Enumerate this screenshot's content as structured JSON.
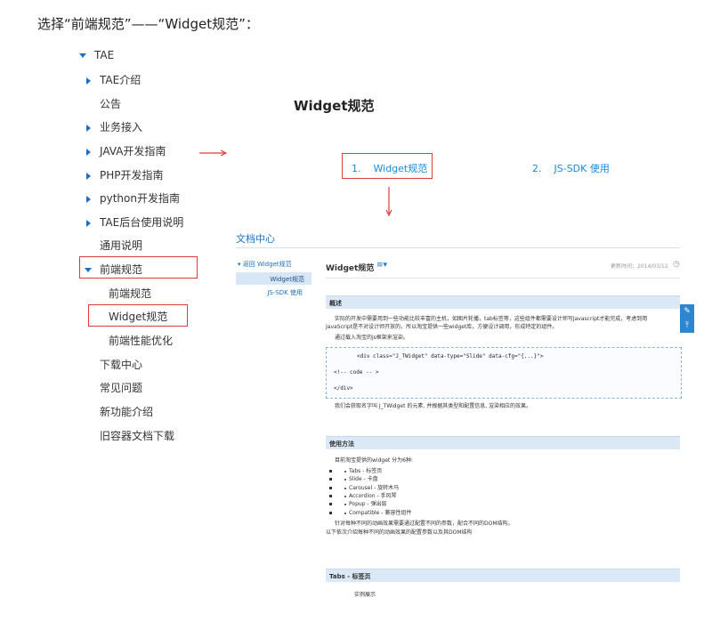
{
  "heading": "选择“前端规范”——“Widget规范”：",
  "tree": {
    "root": "TAE",
    "items": [
      {
        "label": "TAE介绍",
        "arrow": "right"
      },
      {
        "label": "公告",
        "arrow": "none"
      },
      {
        "label": "业务接入",
        "arrow": "right"
      },
      {
        "label": "JAVA开发指南",
        "arrow": "right"
      },
      {
        "label": "PHP开发指南",
        "arrow": "right"
      },
      {
        "label": "python开发指南",
        "arrow": "right"
      },
      {
        "label": "TAE后台使用说明",
        "arrow": "right"
      },
      {
        "label": "通用说明",
        "arrow": "none"
      },
      {
        "label": "前端规范",
        "arrow": "down"
      },
      {
        "label": "前端规范",
        "arrow": "none"
      },
      {
        "label": "Widget规范",
        "arrow": "none"
      },
      {
        "label": "前端性能优化",
        "arrow": "none"
      },
      {
        "label": "下载中心",
        "arrow": "none"
      },
      {
        "label": "常见问题",
        "arrow": "none"
      },
      {
        "label": "新功能介绍",
        "arrow": "none"
      },
      {
        "label": "旧容器文档下载",
        "arrow": "none"
      }
    ]
  },
  "center": {
    "title": "Widget规范",
    "tabs": [
      {
        "num": "1.",
        "label": "Widget规范"
      },
      {
        "num": "2.",
        "label": "JS-SDK 使用"
      }
    ]
  },
  "doc": {
    "center_label": "文档中心",
    "sidebar": {
      "back": "返回 Widget规范",
      "active": "Widget规范",
      "sub": "JS-SDK 使用"
    },
    "title": "Widget规范",
    "menu_icon": "≡▾",
    "updated": "更新时间：2014/03/12",
    "sections": {
      "overview": "概述",
      "usage": "使用方法",
      "tabs": "Tabs - 标签页"
    },
    "overview_text": [
      "实际的开发中需要用到一些功能比较丰富的主机，如图片轮播，tab标签等，这些组件都需要设计师写Javascript才能完成，考虑到用",
      "JavaScript是不对设计师开放的，所以淘宝提供一些widget库，方便设计调用，形成特定的组件。",
      "通过载入淘宝的js框架来渲染。"
    ],
    "code": [
      "<div class=\"J_TWidget\" data-type=\"Slide\" data-cfg=\"{...}\">",
      "<!--  code  -- >",
      "</div>"
    ],
    "after_code": "我们会获取名字叫 J_TWidget 的元素, 并根据其类型和配置信息, 渲染相应的效果。",
    "usage_intro": "目前淘宝提供的widget 分为6种:",
    "usage_items": [
      "Tabs - 标签页",
      "Slide - 卡盘",
      "Carousel - 旋转木马",
      "Accordion - 手风琴",
      "Popup - 弹出层",
      "Compatible - 兼容性组件"
    ],
    "usage_after": [
      "针对每种不同的动画效果需要通过配置不同的参数，配合不同的DOM结构。",
      "以下依次介绍每种不同的动画效果的配置参数以及其DOM结构"
    ],
    "tabs_demo": "实例展示"
  },
  "colors": {
    "red": "#e03a3a",
    "blue": "#1a8ad6"
  }
}
